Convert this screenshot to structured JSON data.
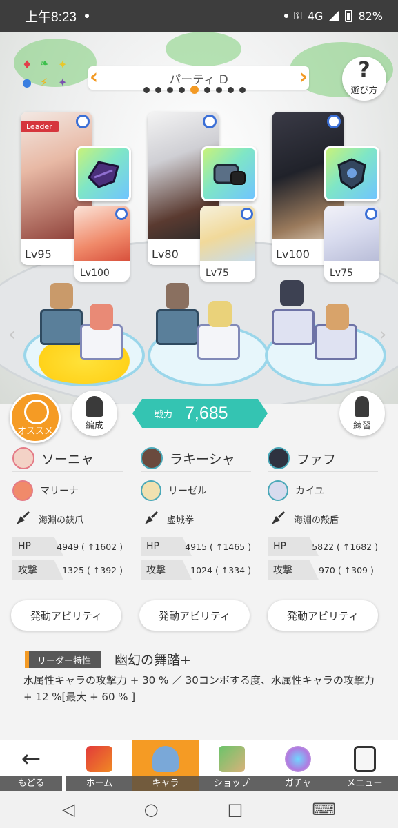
{
  "status_bar": {
    "time": "上午8:23",
    "network": "4G",
    "battery": "82%"
  },
  "top": {
    "party_name": "パーティ D",
    "page_dots": 8,
    "active_dot": 4,
    "help_label": "遊び方",
    "element_icons": [
      "fire-icon",
      "wood-icon",
      "light-icon",
      "water-icon",
      "thunder-icon",
      "dark-icon"
    ]
  },
  "cards": [
    {
      "leader_label": "Leader",
      "main_level": "Lv95",
      "sub_level": "Lv100"
    },
    {
      "main_level": "Lv80",
      "sub_level": "Lv75"
    },
    {
      "main_level": "Lv100",
      "sub_level": "Lv75"
    }
  ],
  "actions": {
    "recommend_label": "オススメ",
    "formation_label": "編成",
    "practice_label": "練習",
    "power_label": "戦力",
    "power_value": "7,685"
  },
  "columns": [
    {
      "main": "ソーニャ",
      "sub": "マリーナ",
      "weapon": "海淵の鋏爪",
      "hp_label": "HP",
      "hp": "4949 ( ↑1602 )",
      "atk_label": "攻撃",
      "atk": "1325 ( ↑392 )",
      "ability": "発動アビリティ"
    },
    {
      "main": "ラキーシャ",
      "sub": "リーゼル",
      "weapon": "虚城拳",
      "hp_label": "HP",
      "hp": "4915 ( ↑1465 )",
      "atk_label": "攻撃",
      "atk": "1024 ( ↑334 )",
      "ability": "発動アビリティ"
    },
    {
      "main": "ファフ",
      "sub": "カイユ",
      "weapon": "海淵の殻盾",
      "hp_label": "HP",
      "hp": "5822 ( ↑1682 )",
      "atk_label": "攻撃",
      "atk": "970 ( ↑309 )",
      "ability": "発動アビリティ"
    }
  ],
  "leader": {
    "tag": "リーダー特性",
    "name": "幽幻の舞踏+",
    "description": "水属性キャラの攻撃力 + 30 % ／ 30コンボする度、水属性キャラの攻撃力 + 12 %[最大 + 60 % ]"
  },
  "nav": [
    {
      "label": "もどる",
      "icon": "back-arrow-icon"
    },
    {
      "label": "ホーム",
      "icon": "home-icon"
    },
    {
      "label": "キャラ",
      "icon": "character-icon",
      "active": true
    },
    {
      "label": "ショップ",
      "icon": "shop-icon"
    },
    {
      "label": "ガチャ",
      "icon": "gacha-icon"
    },
    {
      "label": "メニュー",
      "icon": "menu-icon"
    }
  ],
  "colors": {
    "accent": "#f59b24",
    "power": "#34c4b2",
    "ring": "#3b6fd6",
    "leader": "#d6363d"
  }
}
